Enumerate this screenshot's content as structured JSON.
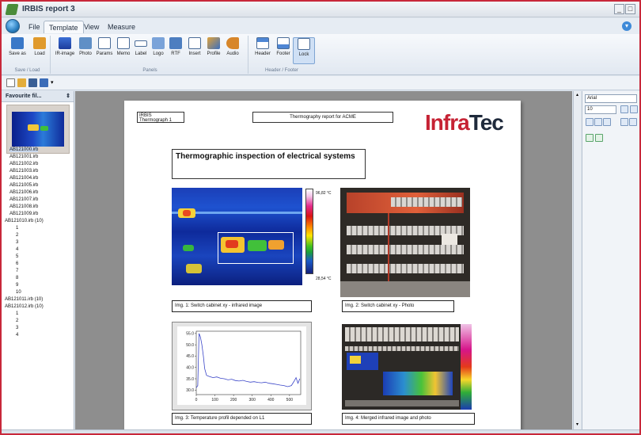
{
  "window": {
    "title": "IRBIS report 3"
  },
  "menu": {
    "tabs": [
      "File",
      "Template",
      "View",
      "Measure"
    ],
    "active_tab": "Template"
  },
  "ribbon": {
    "groups": [
      {
        "label": "Save / Load",
        "buttons": [
          "Save as",
          "Load"
        ]
      },
      {
        "label": "Panels",
        "buttons": [
          "IR-image",
          "Photo",
          "Params",
          "Memo",
          "Label",
          "Logo",
          "RTF",
          "Insert",
          "Profile",
          "Audio"
        ]
      },
      {
        "label": "Header / Footer",
        "buttons": [
          "Header",
          "Footer",
          "Lock"
        ]
      }
    ]
  },
  "left_panel": {
    "header": "Favourite fil...",
    "files": [
      "AB121000.irb",
      "AB121001.irb",
      "AB121002.irb",
      "AB121003.irb",
      "AB121004.irb",
      "AB121005.irb",
      "AB121006.irb",
      "AB121007.irb",
      "AB121008.irb",
      "AB121009.irb"
    ],
    "group1": {
      "label": "AB121010.irb (10)",
      "children": [
        "1",
        "2",
        "3",
        "4",
        "5",
        "6",
        "7",
        "8",
        "9",
        "10"
      ]
    },
    "group2": {
      "label": "AB121011.irb (10)"
    },
    "group3": {
      "label": "AB121012.irb (10)",
      "children": [
        "1",
        "2",
        "3",
        "4"
      ]
    }
  },
  "report": {
    "header_left_line1": "IRBIS",
    "header_left_line2": "Thermograph 1",
    "header_center": "Thermography report for ACME",
    "logo_infra": "Infra",
    "logo_tec": "Tec",
    "title": "Thermographic inspection of electrical systems",
    "scale_max": "96,82 °C",
    "scale_min": "28,54 °C",
    "captions": [
      "Img. 1: Switch cabinet xy - infrared image",
      "Img. 2: Switch cabinet xy - Photo",
      "Img. 3: Temperature profil depended on L1",
      "Img. 4: Merged infrared image and photo"
    ]
  },
  "chart_data": {
    "type": "line",
    "title": "",
    "xlabel": "",
    "ylabel": "",
    "x_ticks": [
      0,
      100,
      200,
      300,
      400,
      500
    ],
    "y_ticks": [
      30.0,
      35.0,
      40.0,
      45.0,
      50.0,
      55.0
    ],
    "xlim": [
      0,
      560
    ],
    "ylim": [
      28.0,
      56.0
    ],
    "series": [
      {
        "x": [
          0,
          8,
          15,
          22,
          30,
          38,
          45,
          55,
          70,
          90,
          110,
          130,
          150,
          170,
          190,
          210,
          230,
          250,
          270,
          290,
          310,
          330,
          350,
          370,
          390,
          410,
          430,
          450,
          470,
          490,
          510,
          525,
          535,
          545,
          555
        ],
        "values": [
          31.0,
          32.0,
          55.0,
          53.5,
          50.0,
          45.0,
          39.5,
          36.5,
          36.0,
          35.5,
          35.8,
          35.2,
          35.0,
          34.5,
          34.8,
          34.2,
          34.0,
          34.3,
          33.8,
          33.5,
          33.7,
          33.4,
          33.2,
          33.5,
          33.0,
          32.8,
          32.5,
          32.2,
          32.0,
          31.5,
          32.0,
          34.0,
          35.5,
          33.0,
          35.0
        ]
      }
    ]
  },
  "right_panel": {
    "font_name": "Arial",
    "font_size": "10"
  },
  "colors": {
    "accent": "#2a7fc0",
    "window_border": "#c8283a",
    "logo_red": "#c62234"
  }
}
